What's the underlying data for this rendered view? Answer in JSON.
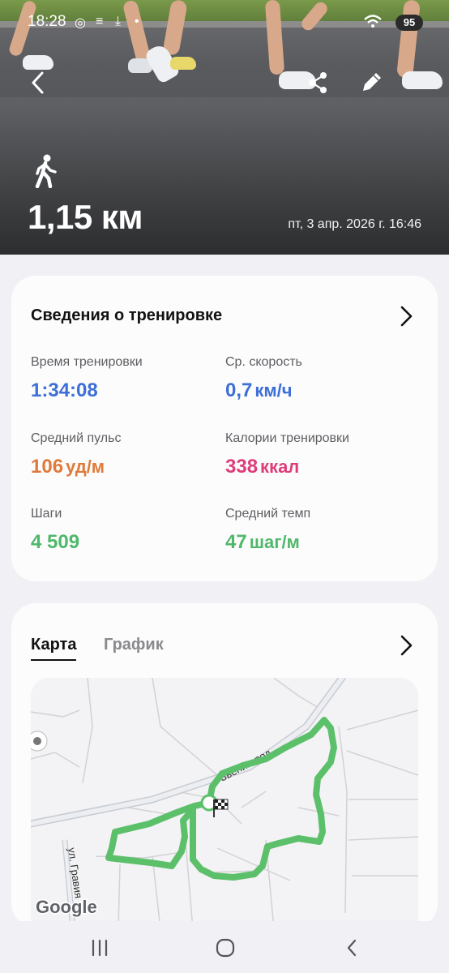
{
  "status_bar": {
    "time": "18:28",
    "battery": "95"
  },
  "hero": {
    "distance": "1,15 км",
    "datetime": "пт, 3 апр. 2026 г. 16:46",
    "activity_icon": "walking-icon"
  },
  "summary": {
    "title": "Сведения о тренировке",
    "metrics": [
      {
        "label": "Время тренировки",
        "value": "1:34:08",
        "unit": "",
        "color": "#3d6fd6"
      },
      {
        "label": "Ср. скорость",
        "value": "0,7",
        "unit": "км/ч",
        "color": "#3d6fd6"
      },
      {
        "label": "Средний пульс",
        "value": "106",
        "unit": "уд/м",
        "color": "#e07a3a"
      },
      {
        "label": "Калории тренировки",
        "value": "338",
        "unit": "ккал",
        "color": "#de3d7a"
      },
      {
        "label": "Шаги",
        "value": "4 509",
        "unit": "",
        "color": "#4fb86a"
      },
      {
        "label": "Средний темп",
        "value": "47",
        "unit": "шаг/м",
        "color": "#4fb86a"
      }
    ]
  },
  "map_card": {
    "tabs": [
      "Карта",
      "График"
    ],
    "active_tab": "Карта",
    "street_labels": [
      "Звенигород",
      "ул. Гравия"
    ],
    "attribution": "Google",
    "route_color": "#5cc06a"
  }
}
